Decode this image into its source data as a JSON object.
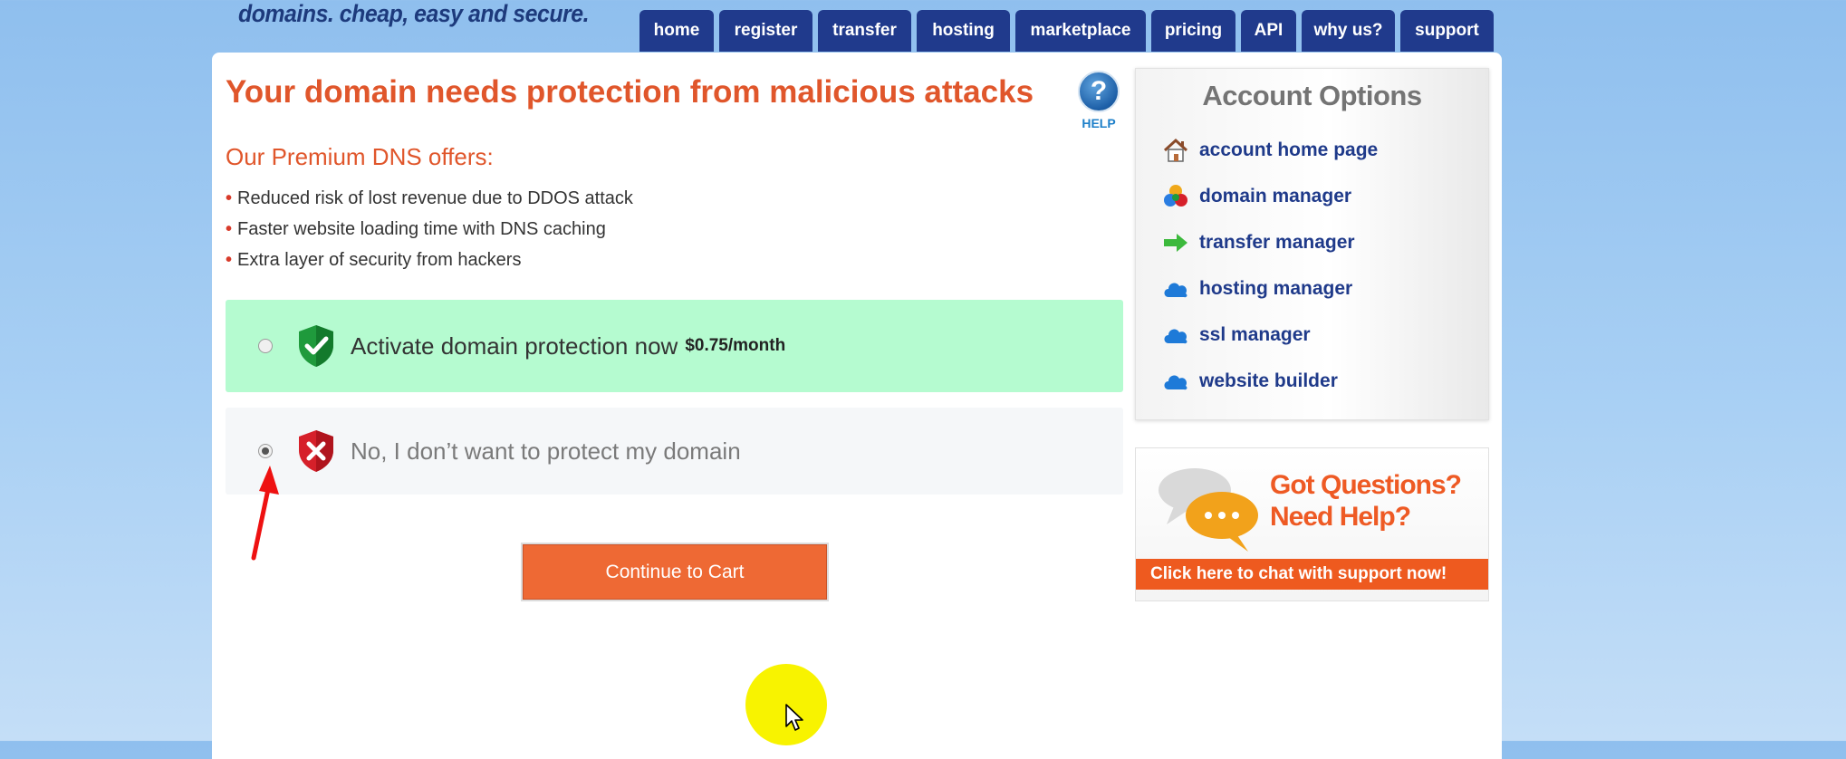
{
  "brand": {
    "tagline": "domains. cheap, easy and secure."
  },
  "nav": {
    "tabs": [
      {
        "label": "home"
      },
      {
        "label": "register"
      },
      {
        "label": "transfer"
      },
      {
        "label": "hosting"
      },
      {
        "label": "marketplace"
      },
      {
        "label": "pricing"
      },
      {
        "label": "API"
      },
      {
        "label": "why us?"
      },
      {
        "label": "support"
      }
    ]
  },
  "main": {
    "headline": "Your domain needs protection from malicious attacks",
    "help_label": "HELP",
    "help_glyph": "?",
    "subhead": "Our Premium DNS offers:",
    "bullets": [
      "Reduced risk of lost revenue due to DDOS attack",
      "Faster website loading time with DNS caching",
      "Extra layer of security from hackers"
    ],
    "bullet_glyph": "•",
    "option_yes": {
      "label": "Activate domain protection now",
      "price": "$0.75/month",
      "checked": false,
      "color": "#b5fbd0"
    },
    "option_no": {
      "label": "No, I don’t want to protect my domain",
      "checked": true
    },
    "continue_button": "Continue to Cart",
    "accent_color": "#e0562b"
  },
  "account_options": {
    "title": "Account Options",
    "items": [
      {
        "label": "account home page",
        "icon": "house-icon"
      },
      {
        "label": "domain manager",
        "icon": "colored-circles-icon"
      },
      {
        "label": "transfer manager",
        "icon": "green-arrow-icon"
      },
      {
        "label": "hosting manager",
        "icon": "cloud-icon"
      },
      {
        "label": "ssl manager",
        "icon": "cloud-icon"
      },
      {
        "label": "website builder",
        "icon": "cloud-icon"
      }
    ]
  },
  "support_box": {
    "line1": "Got Questions?",
    "line2": "Need Help?",
    "cta": "Click here to chat with support now!"
  }
}
